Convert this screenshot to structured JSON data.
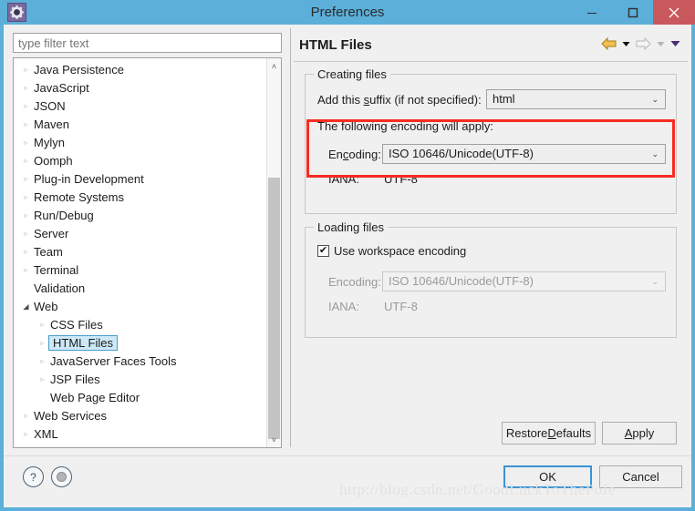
{
  "window": {
    "title": "Preferences",
    "icon": "gear-icon",
    "titlebar_color": "#5BAFD9",
    "minimize_label": "—",
    "maximize_label": "❐",
    "close_label": "✕"
  },
  "filter": {
    "placeholder": "type filter text",
    "value": ""
  },
  "tree": {
    "items": [
      {
        "label": "Java Persistence",
        "indent": 0,
        "state": "collapsed",
        "selected": false
      },
      {
        "label": "JavaScript",
        "indent": 0,
        "state": "collapsed",
        "selected": false
      },
      {
        "label": "JSON",
        "indent": 0,
        "state": "collapsed",
        "selected": false
      },
      {
        "label": "Maven",
        "indent": 0,
        "state": "collapsed",
        "selected": false
      },
      {
        "label": "Mylyn",
        "indent": 0,
        "state": "collapsed",
        "selected": false
      },
      {
        "label": "Oomph",
        "indent": 0,
        "state": "collapsed",
        "selected": false
      },
      {
        "label": "Plug-in Development",
        "indent": 0,
        "state": "collapsed",
        "selected": false
      },
      {
        "label": "Remote Systems",
        "indent": 0,
        "state": "collapsed",
        "selected": false
      },
      {
        "label": "Run/Debug",
        "indent": 0,
        "state": "collapsed",
        "selected": false
      },
      {
        "label": "Server",
        "indent": 0,
        "state": "collapsed",
        "selected": false
      },
      {
        "label": "Team",
        "indent": 0,
        "state": "collapsed",
        "selected": false
      },
      {
        "label": "Terminal",
        "indent": 0,
        "state": "collapsed",
        "selected": false
      },
      {
        "label": "Validation",
        "indent": 0,
        "state": "none",
        "selected": false
      },
      {
        "label": "Web",
        "indent": 0,
        "state": "expanded",
        "selected": false
      },
      {
        "label": "CSS Files",
        "indent": 1,
        "state": "collapsed",
        "selected": false
      },
      {
        "label": "HTML Files",
        "indent": 1,
        "state": "collapsed",
        "selected": true
      },
      {
        "label": "JavaServer Faces Tools",
        "indent": 1,
        "state": "collapsed",
        "selected": false
      },
      {
        "label": "JSP Files",
        "indent": 1,
        "state": "collapsed",
        "selected": false
      },
      {
        "label": "Web Page Editor",
        "indent": 1,
        "state": "none",
        "selected": false
      },
      {
        "label": "Web Services",
        "indent": 0,
        "state": "collapsed",
        "selected": false
      },
      {
        "label": "XML",
        "indent": 0,
        "state": "collapsed",
        "selected": false
      }
    ],
    "scrollbar": {
      "up_glyph": "˄",
      "down_glyph": "˅"
    }
  },
  "panel": {
    "title": "HTML Files",
    "nav": {
      "back_icon": "back-arrow-icon",
      "back_menu_icon": "chevron-down-icon",
      "forward_icon": "forward-arrow-icon",
      "forward_menu_icon": "chevron-down-icon",
      "view_menu_icon": "chevron-down-icon"
    },
    "creating": {
      "group_title": "Creating files",
      "suffix_label_pre": "Add this ",
      "suffix_label_mnemonic": "s",
      "suffix_label_post": "uffix (if not specified):",
      "suffix_value": "html",
      "encoding_note": "The following encoding will apply:",
      "encoding_label_pre": "En",
      "encoding_label_mnemonic": "c",
      "encoding_label_post": "oding:",
      "encoding_value": "ISO 10646/Unicode(UTF-8)",
      "iana_label": "IANA:",
      "iana_value": "UTF-8",
      "highlight_color": "#f72c22"
    },
    "loading": {
      "group_title": "Loading files",
      "use_workspace_label": "Use workspace encoding",
      "use_workspace_checked": true,
      "check_glyph": "✔",
      "encoding_label": "Encoding:",
      "encoding_value": "ISO 10646/Unicode(UTF-8)",
      "iana_label": "IANA:",
      "iana_value": "UTF-8",
      "disabled": true
    },
    "buttons": {
      "restore_pre": "Restore ",
      "restore_mnemonic": "D",
      "restore_post": "efaults",
      "apply_mnemonic": "A",
      "apply_post": "pply"
    },
    "combo_caret": "⌄"
  },
  "footer": {
    "help_icon": "question-mark-icon",
    "help_glyph": "?",
    "tray_icon": "tray-toggle-icon",
    "ok_label": "OK",
    "cancel_label": "Cancel"
  },
  "watermark": {
    "text": "http://blog.csdn.net/GoodLuckToThePoIe"
  }
}
